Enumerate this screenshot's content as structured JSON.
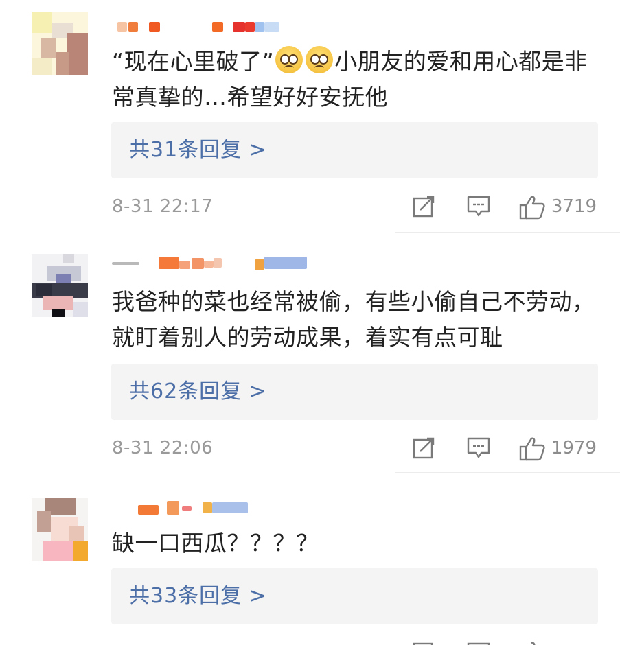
{
  "comments": [
    {
      "text_before": "“现在心里破了”",
      "text_after": "小朋友的爱和用心都是非常真挚的…希望好好安抚他",
      "emojis": [
        "pleading-face",
        "pleading-face"
      ],
      "reply_label": "共31条回复 >",
      "timestamp": "8-31 22:17",
      "likes": "3719"
    },
    {
      "text_before": "我爸种的菜也经常被偷，有些小偷自己不劳动，就盯着别人的劳动成果，着实有点可耻",
      "text_after": "",
      "emojis": [],
      "reply_label": "共62条回复 >",
      "timestamp": "8-31 22:06",
      "likes": "1979"
    },
    {
      "text_before": "缺一口西瓜？？？？",
      "text_after": "",
      "emojis": [],
      "reply_label": "共33条回复 >",
      "timestamp": "",
      "likes": ""
    }
  ],
  "icons": {
    "share": "share-icon",
    "comment": "comment-icon",
    "like": "thumbs-up-icon"
  },
  "colors": {
    "reply_link": "#4d6fa8",
    "reply_bg": "#f4f4f4",
    "meta_text": "#9a9a9a"
  }
}
